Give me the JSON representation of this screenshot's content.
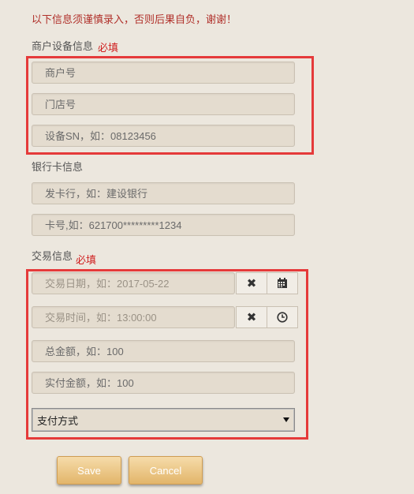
{
  "notice": "以下信息须谨慎录入，否则后果自负，谢谢！",
  "merchant_section": {
    "label": "商户设备信息",
    "required": "必填",
    "merchant_no_placeholder": "商户号",
    "store_no_placeholder": "门店号",
    "device_sn_placeholder": "设备SN，如：08123456"
  },
  "bank_section": {
    "label": "银行卡信息",
    "issuer_placeholder": "发卡行，如：建设银行",
    "card_no_placeholder": "卡号,如：621700*********1234"
  },
  "transaction_section": {
    "label": "交易信息",
    "required": "必填",
    "date_placeholder": "交易日期，如：2017-05-22",
    "time_placeholder": "交易时间，如：13:00:00",
    "total_amount_placeholder": "总金额，如：100",
    "paid_amount_placeholder": "实付金额，如：100",
    "payment_method_selected": "支付方式",
    "clear_glyph": "✖"
  },
  "buttons": {
    "save": "Save",
    "cancel": "Cancel"
  },
  "colors": {
    "highlight_border": "#e53a3a",
    "required_text": "#d02020",
    "button_gold": "#e2b56a"
  }
}
